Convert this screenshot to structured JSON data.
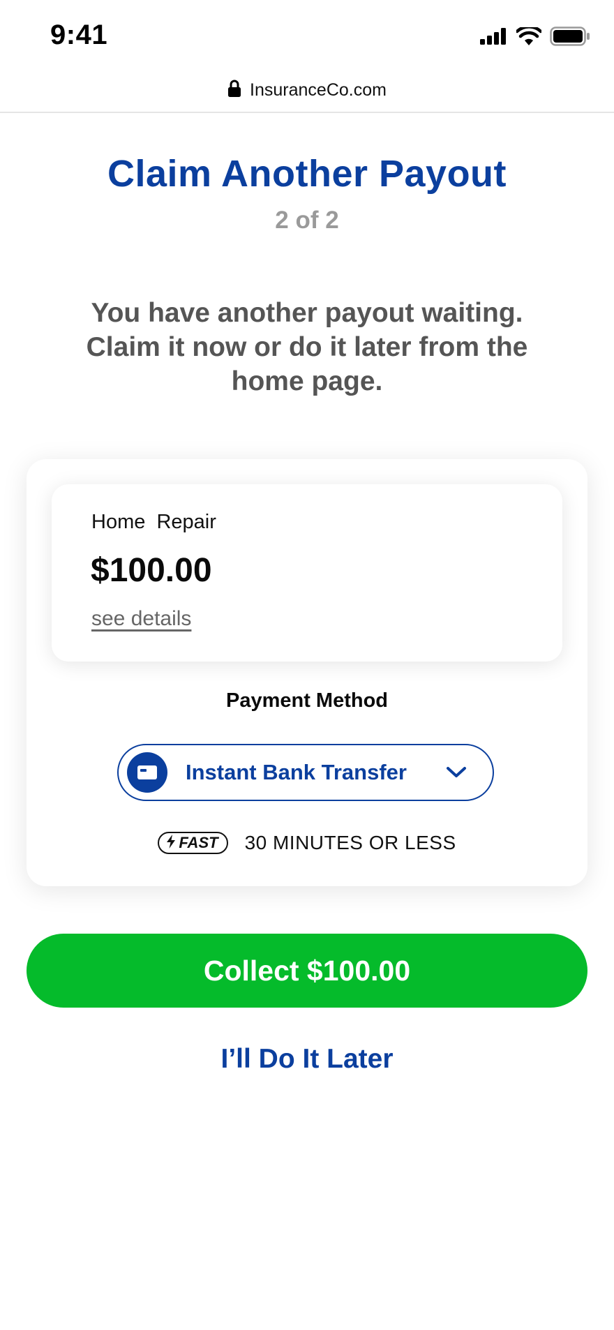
{
  "status_bar": {
    "time": "9:41",
    "icons": [
      "signal-icon",
      "wifi-icon",
      "battery-icon"
    ]
  },
  "browser": {
    "url": "InsuranceCo.com",
    "lock_icon": "lock-icon"
  },
  "header": {
    "title": "Claim Another Payout",
    "step": "2 of 2",
    "message": "You have another payout waiting. Claim it now or do it later from the home page."
  },
  "claim": {
    "category": "Home  Repair",
    "amount": "$100.00",
    "details_link": "see details"
  },
  "payment": {
    "label": "Payment Method",
    "selected_method": "Instant Bank Transfer",
    "method_icon": "bank-card-icon",
    "badge": "FAST",
    "speed_text": "30 MINUTES OR LESS"
  },
  "actions": {
    "collect_label": "Collect $100.00",
    "later_label": "I’ll Do It Later"
  },
  "colors": {
    "primary": "#0b3f9e",
    "success": "#05bb2b",
    "muted": "#9a9a9a",
    "body_text": "#555555"
  }
}
